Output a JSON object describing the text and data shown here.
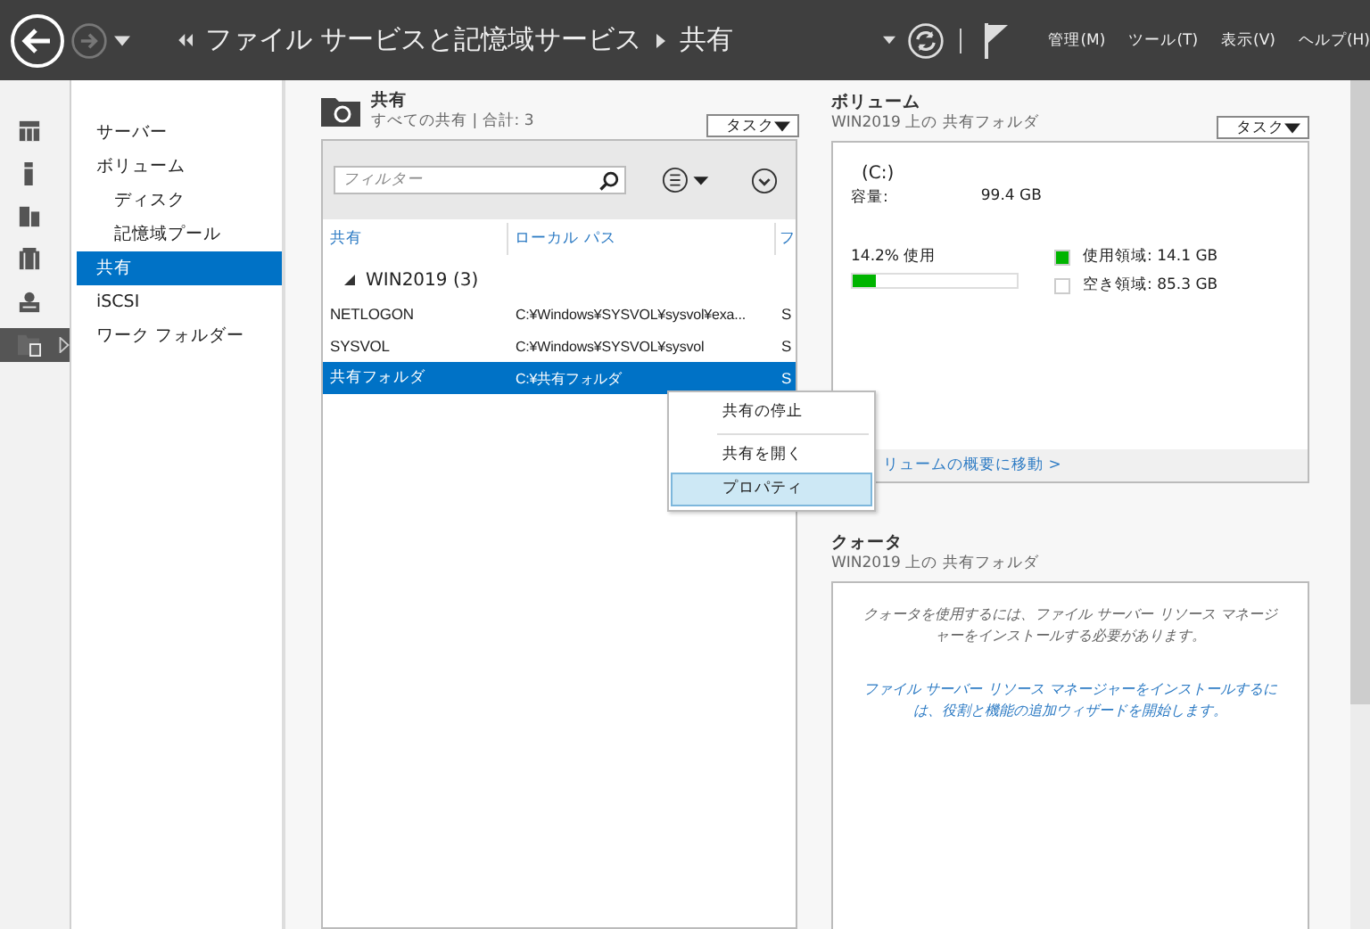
{
  "header": {
    "breadcrumb": [
      "ファイル サービスと記憶域サービス",
      "共有"
    ],
    "menus": [
      "管理(M)",
      "ツール(T)",
      "表示(V)",
      "ヘルプ(H)"
    ]
  },
  "icon_strip": [
    {
      "selected": false
    },
    {
      "selected": false
    },
    {
      "selected": false
    },
    {
      "selected": false
    },
    {
      "selected": false
    },
    {
      "selected": true
    }
  ],
  "nav": {
    "items": [
      {
        "label": "サーバー",
        "selected": false
      },
      {
        "label": "ボリューム",
        "selected": false,
        "children": [
          {
            "label": "ディスク",
            "selected": false
          },
          {
            "label": "記憶域プール",
            "selected": false
          }
        ]
      },
      {
        "label": "共有",
        "selected": true
      },
      {
        "label": "iSCSI",
        "selected": false
      },
      {
        "label": "ワーク フォルダー",
        "selected": false
      }
    ]
  },
  "shares": {
    "title": "共有",
    "subtitle": "すべての共有 | 合計: 3",
    "tasks": "タスク",
    "filter": {
      "placeholder": "フィルター"
    },
    "columns": [
      "共有",
      "ローカル パス",
      "フ"
    ],
    "group": {
      "label": "WIN2019 (3)",
      "expanded": true
    },
    "rows": [
      {
        "cells": [
          "NETLOGON",
          "C:¥Windows¥SYSVOL¥sysvol¥exa...",
          "S"
        ],
        "selected": false
      },
      {
        "cells": [
          "SYSVOL",
          "C:¥Windows¥SYSVOL¥sysvol",
          "S"
        ],
        "selected": false
      },
      {
        "cells": [
          "共有フォルダ",
          "C:¥共有フォルダ",
          "S"
        ],
        "selected": true
      }
    ]
  },
  "context_menu": [
    {
      "label": "共有の停止",
      "selected": false
    },
    {
      "label": "共有を開く",
      "selected": false
    },
    {
      "label": "プロパティ",
      "selected": true
    }
  ],
  "volume": {
    "title": "ボリューム",
    "subtitle": "WIN2019 上の 共有フォルダ",
    "tasks": "タスク",
    "drive": "(C:)",
    "capacity_label": "容量:",
    "capacity": "99.4 GB",
    "usage": "14.2% 使用",
    "level": 0.142,
    "legend": [
      {
        "label": "使用領域: 14.1 GB",
        "color": "#00b400"
      },
      {
        "label": "空き領域: 85.3 GB",
        "color": "#ffffff"
      }
    ],
    "link": "リュームの概要に移動 >"
  },
  "quota": {
    "title": "クォータ",
    "subtitle": "WIN2019 上の 共有フォルダ",
    "message": "クォータを使用するには、ファイル サーバー リソース マネージャーをインストールする必要があります。",
    "link": "ファイル サーバー リソース マネージャーをインストールするには、役割と機能の追加ウィザードを開始します。"
  }
}
